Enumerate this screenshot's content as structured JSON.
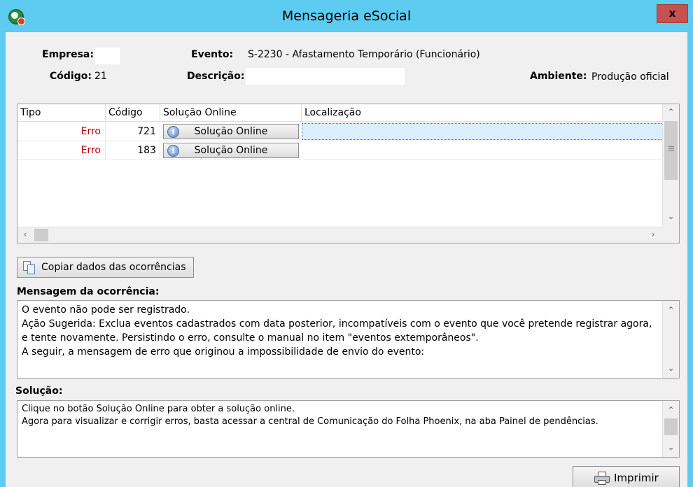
{
  "window": {
    "title": "Mensageria eSocial",
    "close_label": "x"
  },
  "header": {
    "empresa_label": "Empresa:",
    "empresa_value": "",
    "codigo_label": "Código:",
    "codigo_value": "21",
    "evento_label": "Evento:",
    "evento_value": "S-2230 - Afastamento Temporário (Funcionário)",
    "descricao_label": "Descrição:",
    "descricao_value": "",
    "ambiente_label": "Ambiente:",
    "ambiente_value": "Produção oficial"
  },
  "grid": {
    "columns": [
      "Tipo",
      "Código",
      "Solução Online",
      "Localização"
    ],
    "rows": [
      {
        "tipo": "Erro",
        "codigo": "721",
        "solucao": "Solução Online",
        "localizacao": ""
      },
      {
        "tipo": "Erro",
        "codigo": "183",
        "solucao": "Solução Online",
        "localizacao": ""
      }
    ]
  },
  "actions": {
    "copy_label": "Copiar dados das ocorrências",
    "print_label": "Imprimir"
  },
  "mensagem": {
    "title": "Mensagem da ocorrência:",
    "lines": [
      "O evento não pode ser registrado.",
      "Ação Sugerida: Exclua eventos cadastrados com data posterior, incompatíveis com o evento que você pretende registrar agora,",
      "e tente novamente. Persistindo o erro, consulte o manual no item \"eventos extemporâneos\".",
      "A seguir, a mensagem de erro que originou a impossibilidade de envio do evento:"
    ]
  },
  "solucao": {
    "title": "Solução:",
    "lines": [
      "Clique no botão Solução Online para obter a solução online.",
      "Agora para visualizar e corrigir erros, basta acessar a central de Comunicação do Folha Phoenix, na aba Painel de pendências."
    ]
  }
}
